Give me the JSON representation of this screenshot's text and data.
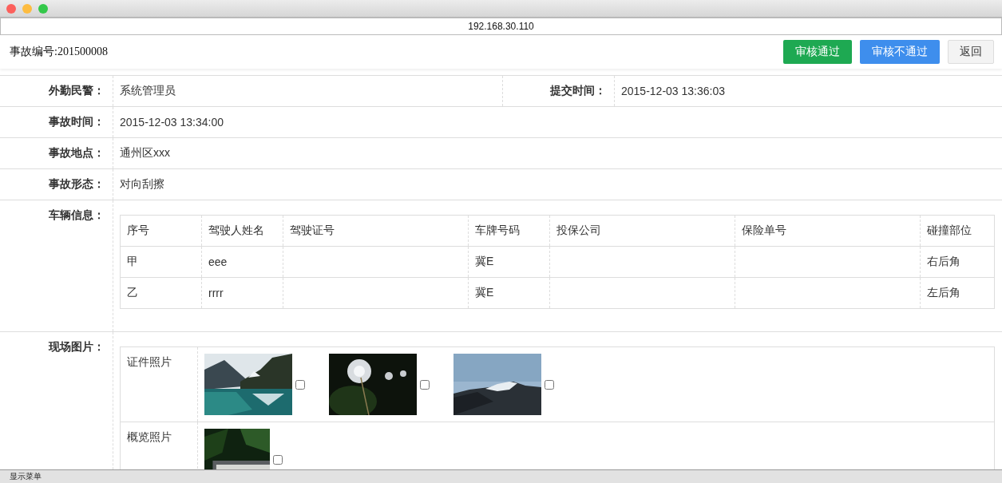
{
  "window": {
    "address": "192.168.30.110"
  },
  "header": {
    "case_number": "事故编号:201500008",
    "buttons": [
      {
        "label": "审核通过",
        "kind": "approve"
      },
      {
        "label": "审核不通过",
        "kind": "reject"
      },
      {
        "label": "返回",
        "kind": "back"
      }
    ]
  },
  "details": {
    "officer_label": "外勤民警：",
    "officer": "系统管理员",
    "submit_label": "提交时间：",
    "submit_time": "2015-12-03 13:36:03",
    "rows": [
      {
        "label": "事故时间：",
        "value": "2015-12-03 13:34:00"
      },
      {
        "label": "事故地点：",
        "value": "通州区xxx"
      },
      {
        "label": "事故形态：",
        "value": "对向刮擦"
      }
    ]
  },
  "vehicles": {
    "label": "车辆信息：",
    "columns": [
      "序号",
      "驾驶人姓名",
      "驾驶证号",
      "车牌号码",
      "投保公司",
      "保险单号",
      "碰撞部位"
    ],
    "rows": [
      [
        "甲",
        "eee",
        "",
        "冀E",
        "",
        "",
        "右后角"
      ],
      [
        "乙",
        "rrrr",
        "",
        "冀E",
        "",
        "",
        "左后角"
      ]
    ]
  },
  "photos": {
    "label": "现场图片：",
    "groups": [
      {
        "name": "证件照片"
      },
      {
        "name": "概览照片"
      }
    ]
  },
  "status_bar": {
    "text": "显示菜单"
  }
}
